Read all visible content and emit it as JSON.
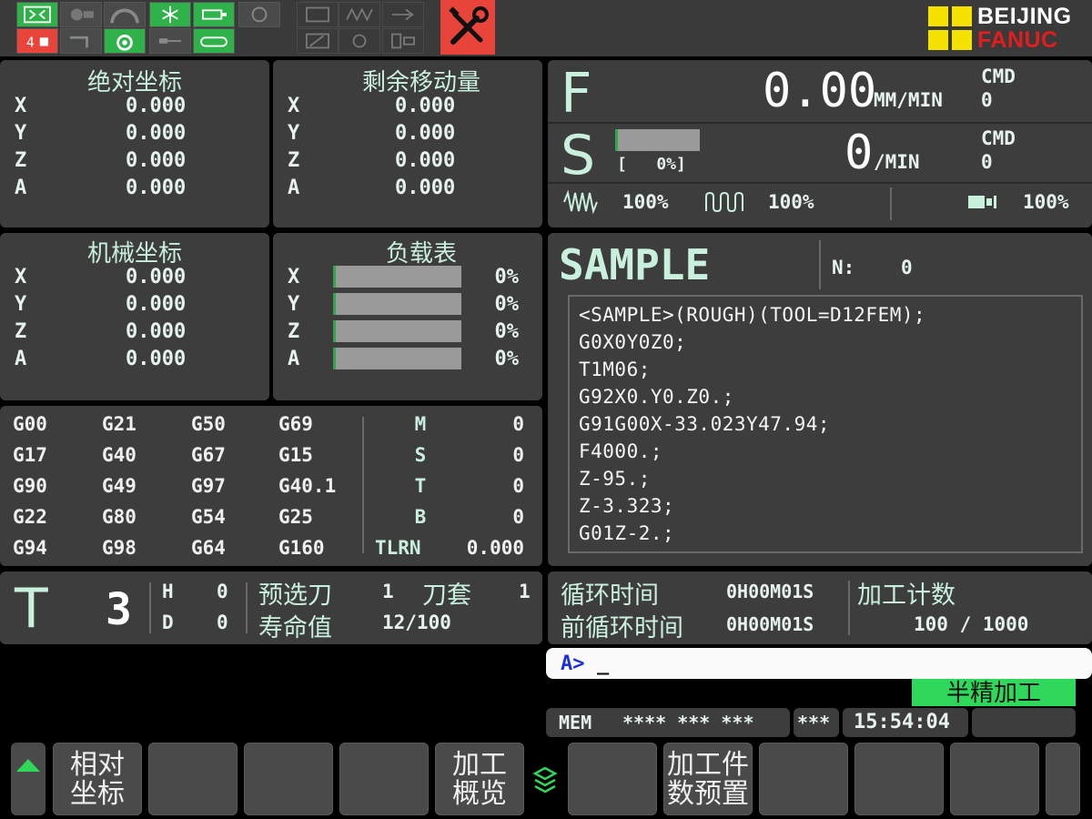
{
  "brand": {
    "line1": "BEIJING",
    "line2": "FANUC"
  },
  "absolute": {
    "title": "绝对坐标",
    "axes": [
      {
        "axis": "X",
        "value": "0.000"
      },
      {
        "axis": "Y",
        "value": "0.000"
      },
      {
        "axis": "Z",
        "value": "0.000"
      },
      {
        "axis": "A",
        "value": "0.000"
      }
    ]
  },
  "remaining": {
    "title": "剩余移动量",
    "axes": [
      {
        "axis": "X",
        "value": "0.000"
      },
      {
        "axis": "Y",
        "value": "0.000"
      },
      {
        "axis": "Z",
        "value": "0.000"
      },
      {
        "axis": "A",
        "value": "0.000"
      }
    ]
  },
  "machine": {
    "title": "机械坐标",
    "axes": [
      {
        "axis": "X",
        "value": "0.000"
      },
      {
        "axis": "Y",
        "value": "0.000"
      },
      {
        "axis": "Z",
        "value": "0.000"
      },
      {
        "axis": "A",
        "value": "0.000"
      }
    ]
  },
  "load": {
    "title": "负载表",
    "axes": [
      {
        "axis": "X",
        "percent": "0%",
        "level": 0
      },
      {
        "axis": "Y",
        "percent": "0%",
        "level": 0
      },
      {
        "axis": "Z",
        "percent": "0%",
        "level": 0
      },
      {
        "axis": "A",
        "percent": "0%",
        "level": 0
      }
    ]
  },
  "gcodes": [
    [
      "G00",
      "G21",
      "G50",
      "G69"
    ],
    [
      "G17",
      "G40",
      "G67",
      "G15"
    ],
    [
      "G90",
      "G49",
      "G97",
      "G40.1"
    ],
    [
      "G22",
      "G80",
      "G54",
      "G25"
    ],
    [
      "G94",
      "G98",
      "G64",
      "G160"
    ]
  ],
  "codes": [
    {
      "label": "M",
      "value": "0"
    },
    {
      "label": "S",
      "value": "0"
    },
    {
      "label": "T",
      "value": "0"
    },
    {
      "label": "B",
      "value": "0"
    },
    {
      "label": "TLRN",
      "value": "0.000"
    }
  ],
  "tool": {
    "letter": "T",
    "number": "3",
    "h_label": "H",
    "h_value": "0",
    "d_label": "D",
    "d_value": "0",
    "preselect_label": "预选刀",
    "preselect_value": "1",
    "pocket_label": "刀套",
    "pocket_value": "1",
    "life_label": "寿命值",
    "life_value": "12/100"
  },
  "feed": {
    "letter": "F",
    "value": "0.00",
    "unit": "MM/MIN",
    "cmd_label": "CMD",
    "cmd_value": "0"
  },
  "spindle": {
    "letter": "S",
    "bar_text": "[   0%]",
    "bar_level": 0,
    "value": "0",
    "unit": "/MIN",
    "cmd_label": "CMD",
    "cmd_value": "0"
  },
  "overrides": [
    {
      "icon": "feed-override-icon",
      "value": "100%"
    },
    {
      "icon": "rapid-override-icon",
      "value": "100%"
    },
    {
      "icon": "spindle-override-icon",
      "value": "100%"
    }
  ],
  "program": {
    "name": "SAMPLE",
    "n_label": "N:",
    "n_value": "0",
    "lines": [
      "<SAMPLE>(ROUGH)(TOOL=D12FEM);",
      "G0X0Y0Z0;",
      "T1M06;",
      "G92X0.Y0.Z0.;",
      "G91G00X-33.023Y47.94;",
      "F4000.;",
      "Z-95.;",
      "Z-3.323;",
      "G01Z-2.;"
    ]
  },
  "cycle": {
    "cycle_label": "循环时间",
    "cycle_value": "0H00M01S",
    "prev_label": "前循环时间",
    "prev_value": "0H00M01S",
    "count_label": "加工计数",
    "count_value": "100 / 1000"
  },
  "input": {
    "prompt": "A>",
    "cursor": "_"
  },
  "mode_badge": "半精加工",
  "status": {
    "mode": "MEM",
    "stars1": "**** *** ***",
    "stars2": "***",
    "time": "15:54:04"
  },
  "softkeys": [
    {
      "label": "相对\n坐标"
    },
    {
      "label": ""
    },
    {
      "label": ""
    },
    {
      "label": ""
    },
    {
      "label": "加工\n概览"
    },
    {
      "label": ""
    },
    {
      "label": "加工件\n数预置"
    },
    {
      "label": ""
    },
    {
      "label": ""
    },
    {
      "label": ""
    },
    {
      "label": ""
    }
  ],
  "colors": {
    "panel": "#3d3d3d",
    "accent_green": "#2fb24a",
    "mint_text": "#c8f0dc",
    "alarm_red": "#e8443a",
    "logo_yellow": "#f5e100",
    "logo_red": "#e21d1d"
  }
}
